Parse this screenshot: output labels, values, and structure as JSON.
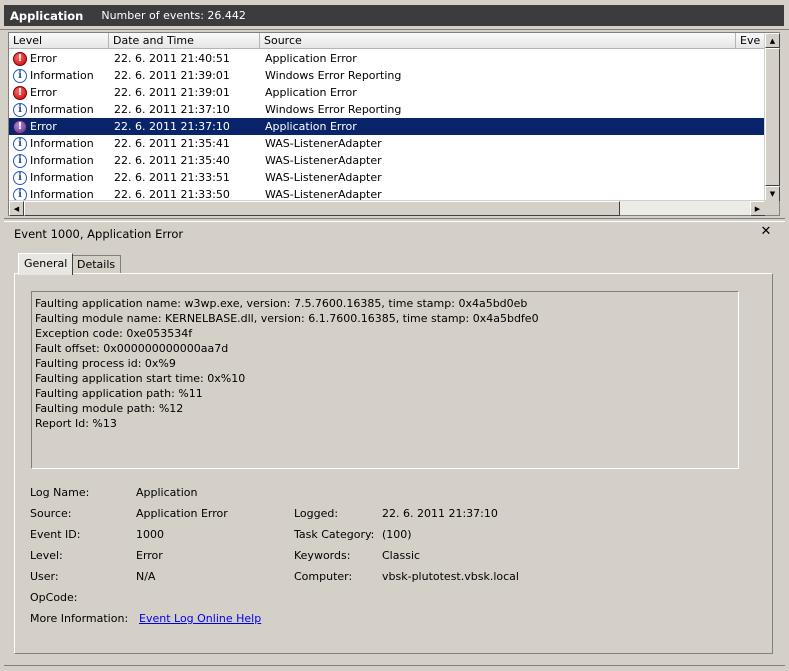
{
  "header": {
    "title": "Application",
    "event_count": "Number of events: 26.442"
  },
  "table": {
    "columns": [
      "Level",
      "Date and Time",
      "Source",
      "Eve"
    ],
    "rows": [
      {
        "level": "Error",
        "icon": "error-icon",
        "datetime": "22. 6. 2011 21:40:51",
        "source": "Application Error",
        "selected": false
      },
      {
        "level": "Information",
        "icon": "information-icon",
        "datetime": "22. 6. 2011 21:39:01",
        "source": "Windows Error Reporting",
        "selected": false
      },
      {
        "level": "Error",
        "icon": "error-icon",
        "datetime": "22. 6. 2011 21:39:01",
        "source": "Application Error",
        "selected": false
      },
      {
        "level": "Information",
        "icon": "information-icon",
        "datetime": "22. 6. 2011 21:37:10",
        "source": "Windows Error Reporting",
        "selected": false
      },
      {
        "level": "Error",
        "icon": "error-icon",
        "datetime": "22. 6. 2011 21:37:10",
        "source": "Application Error",
        "selected": true
      },
      {
        "level": "Information",
        "icon": "information-icon",
        "datetime": "22. 6. 2011 21:35:41",
        "source": "WAS-ListenerAdapter",
        "selected": false
      },
      {
        "level": "Information",
        "icon": "information-icon",
        "datetime": "22. 6. 2011 21:35:40",
        "source": "WAS-ListenerAdapter",
        "selected": false
      },
      {
        "level": "Information",
        "icon": "information-icon",
        "datetime": "22. 6. 2011 21:33:51",
        "source": "WAS-ListenerAdapter",
        "selected": false
      },
      {
        "level": "Information",
        "icon": "information-icon",
        "datetime": "22. 6. 2011 21:33:50",
        "source": "WAS-ListenerAdapter",
        "selected": false
      }
    ]
  },
  "detail": {
    "title": "Event 1000, Application Error",
    "close_glyph": "✕",
    "tabs": [
      "General",
      "Details"
    ],
    "description": [
      "Faulting application name: w3wp.exe, version: 7.5.7600.16385, time stamp: 0x4a5bd0eb",
      "Faulting module name: KERNELBASE.dll, version: 6.1.7600.16385, time stamp: 0x4a5bdfe0",
      "Exception code: 0xe053534f",
      "Fault offset: 0x000000000000aa7d",
      "Faulting process id: 0x%9",
      "Faulting application start time: 0x%10",
      "Faulting application path: %11",
      "Faulting module path: %12",
      "Report Id: %13"
    ],
    "properties": {
      "log_name_label": "Log Name:",
      "log_name": "Application",
      "source_label": "Source:",
      "source": "Application Error",
      "logged_label": "Logged:",
      "logged": "22. 6. 2011 21:37:10",
      "event_id_label": "Event ID:",
      "event_id": "1000",
      "task_category_label": "Task Category:",
      "task_category": "(100)",
      "level_label": "Level:",
      "level": "Error",
      "keywords_label": "Keywords:",
      "keywords": "Classic",
      "user_label": "User:",
      "user": "N/A",
      "computer_label": "Computer:",
      "computer": "vbsk-plutotest.vbsk.local",
      "opcode_label": "OpCode:",
      "more_info_label": "More Information:",
      "more_info_link": "Event Log Online Help"
    }
  },
  "colors": {
    "selected_row": "#0a246a",
    "header_bar": "#3c3c3c",
    "window_bg": "#d4d0c8",
    "link": "#0000ee"
  }
}
